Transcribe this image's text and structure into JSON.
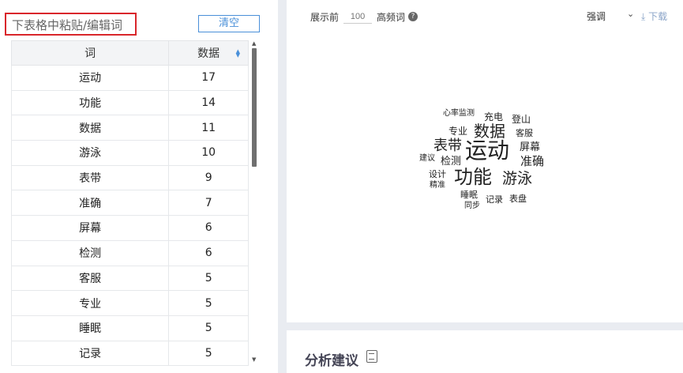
{
  "left_panel": {
    "paste_placeholder": "下表格中粘贴/编辑词",
    "clear_label": "清空",
    "table": {
      "headers": [
        "词",
        "数据"
      ],
      "rows": [
        [
          "运动",
          "17"
        ],
        [
          "功能",
          "14"
        ],
        [
          "数据",
          "11"
        ],
        [
          "游泳",
          "10"
        ],
        [
          "表带",
          "9"
        ],
        [
          "准确",
          "7"
        ],
        [
          "屏幕",
          "6"
        ],
        [
          "检测",
          "6"
        ],
        [
          "客服",
          "5"
        ],
        [
          "专业",
          "5"
        ],
        [
          "睡眠",
          "5"
        ],
        [
          "记录",
          "5"
        ]
      ]
    }
  },
  "toolbar": {
    "show_label": "展示前",
    "topn_placeholder": "100",
    "high_freq_label": "高频词",
    "help_icon": "question-circle-icon",
    "emphasis_label": "强调",
    "emphasis_icon": "chevron-down-icon",
    "download_label": "下载",
    "download_icon": "download-icon"
  },
  "word_cloud": {
    "words": [
      "心率监测",
      "充电",
      "登山",
      "专业",
      "数据",
      "客服",
      "表带",
      "运动",
      "屏幕",
      "建议",
      "检测",
      "准确",
      "设计",
      "功能",
      "游泳",
      "精准",
      "睡眠",
      "记录",
      "表盘",
      "同步"
    ]
  },
  "analysis": {
    "title": "分析建议",
    "icon": "document-icon"
  }
}
